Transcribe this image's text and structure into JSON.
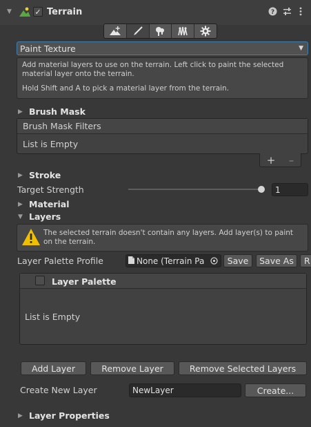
{
  "header": {
    "title": "Terrain",
    "enabled_check": "✓",
    "icons": [
      "help-icon",
      "settings-sliders-icon",
      "more-icon"
    ]
  },
  "toolbar": {
    "tools": [
      "raise-terrain-icon",
      "paint-brush-icon",
      "tree-icon",
      "details-icon",
      "settings-gear-icon"
    ],
    "active": "paint-brush-icon"
  },
  "tool_select": {
    "value": "Paint Texture"
  },
  "description": {
    "line1": "Add material layers to use on the terrain. Left click to paint the selected material layer onto the terrain.",
    "line2": "Hold Shift and A to pick a material layer from the terrain."
  },
  "brush_mask": {
    "section_label": "Brush Mask",
    "list_header": "Brush Mask Filters",
    "empty_text": "List is Empty",
    "add": "+",
    "remove": "–"
  },
  "stroke": {
    "section_label": "Stroke",
    "target_strength_label": "Target Strength",
    "target_strength_value": "1",
    "target_strength_fraction": 1.0
  },
  "material": {
    "section_label": "Material"
  },
  "layers": {
    "section_label": "Layers",
    "warning": "The selected terrain doesn't contain any layers. Add layer(s) to paint on the terrain.",
    "palette_profile_label": "Layer Palette Profile",
    "palette_profile_value": "None (Terrain Pa",
    "save": "Save",
    "save_as": "Save As",
    "revert": "R",
    "palette_header": "Layer Palette",
    "palette_empty": "List is Empty",
    "add_layer": "Add Layer",
    "remove_layer": "Remove Layer",
    "remove_selected": "Remove Selected Layers",
    "create_new_label": "Create New Layer",
    "new_layer_name": "NewLayer",
    "create_button": "Create..."
  },
  "layer_properties": {
    "section_label": "Layer Properties"
  },
  "colors": {
    "background": "#383838",
    "accent_blue": "#3c7fb1",
    "warning_yellow": "#f0c000",
    "terrain_icon_green": "#5aa843"
  }
}
